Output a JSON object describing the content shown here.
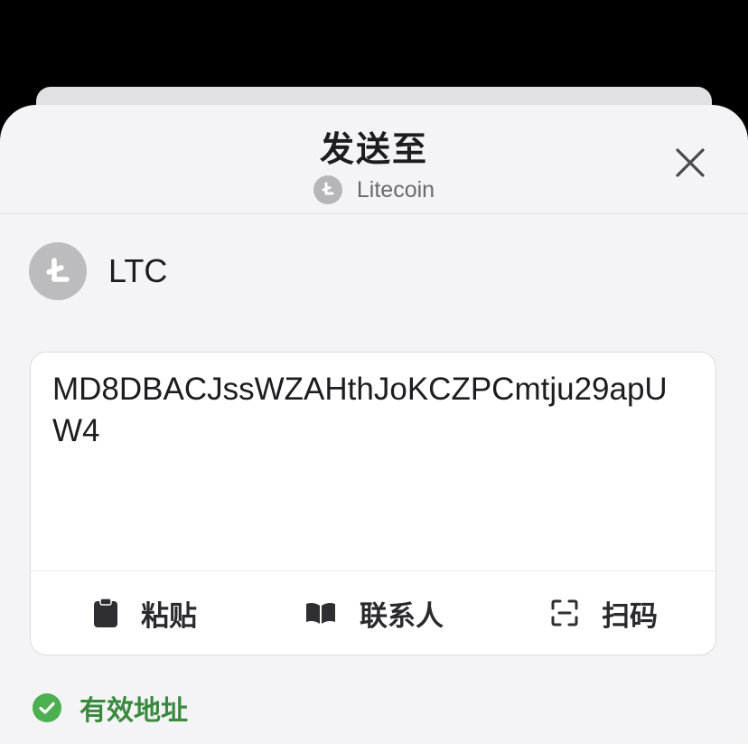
{
  "header": {
    "title": "发送至",
    "network_name": "Litecoin",
    "network_icon": "litecoin-icon",
    "close_icon": "close-icon"
  },
  "asset": {
    "symbol": "LTC",
    "icon": "litecoin-icon"
  },
  "address_input": {
    "value": "MD8DBACJssWZAHthJoKCZPCmtju29apUW4"
  },
  "actions": [
    {
      "label": "粘贴",
      "icon": "clipboard-icon"
    },
    {
      "label": "联系人",
      "icon": "book-icon"
    },
    {
      "label": "扫码",
      "icon": "scan-icon"
    }
  ],
  "status": {
    "text": "有效地址",
    "icon": "check-circle-icon",
    "color": "#3a8a3e"
  },
  "colors": {
    "sheet_background": "#f4f4f6",
    "coin_gray": "#b6b6b8",
    "status_green": "#4caf50"
  }
}
